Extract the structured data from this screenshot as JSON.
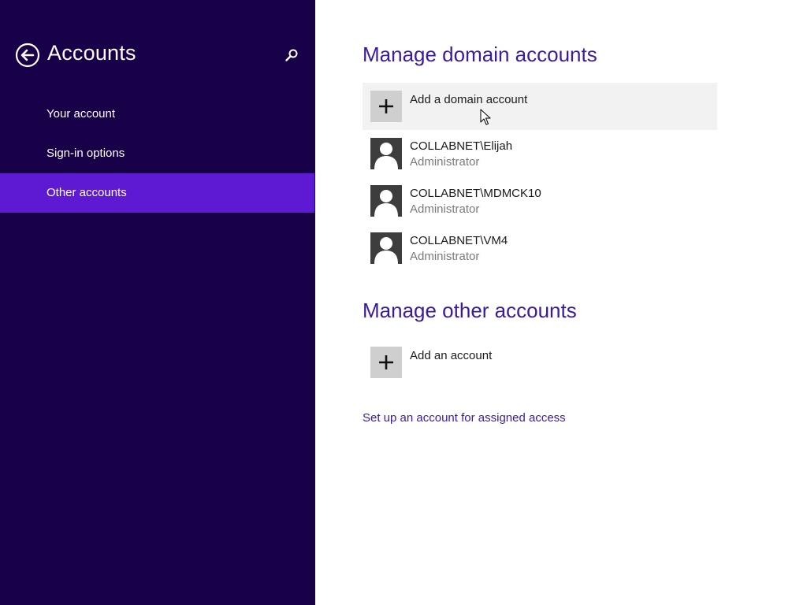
{
  "sidebar": {
    "title": "Accounts",
    "back_icon": "back-arrow-icon",
    "search_icon": "search-icon",
    "items": [
      {
        "label": "Your account",
        "selected": false
      },
      {
        "label": "Sign-in options",
        "selected": false
      },
      {
        "label": "Other accounts",
        "selected": true
      }
    ]
  },
  "main": {
    "domain_section": {
      "title": "Manage domain accounts",
      "add_label": "Add a domain account",
      "accounts": [
        {
          "name": "COLLABNET\\Elijah",
          "role": "Administrator"
        },
        {
          "name": "COLLABNET\\MDMCK10",
          "role": "Administrator"
        },
        {
          "name": "COLLABNET\\VM4",
          "role": "Administrator"
        }
      ]
    },
    "other_section": {
      "title": "Manage other accounts",
      "add_label": "Add an account"
    },
    "assigned_access_link": "Set up an account for assigned access"
  },
  "colors": {
    "sidebar_bg": "#180048",
    "selected_item": "#5d1ad2",
    "accent_text": "#3a1b9e"
  }
}
